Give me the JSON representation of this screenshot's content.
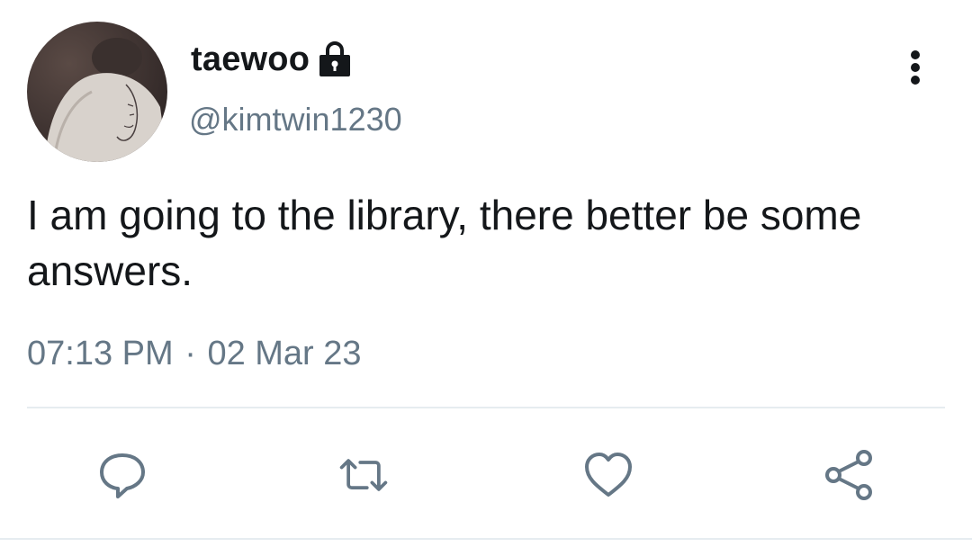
{
  "tweet": {
    "author": {
      "display_name": "taewoo",
      "handle": "@kimtwin1230",
      "protected": true,
      "avatar_icon": "profile-photo"
    },
    "text": "I am going to the library, there better be some answers.",
    "time": "07:13 PM",
    "separator": "·",
    "date": "02 Mar 23"
  },
  "actions": [
    {
      "name": "reply",
      "icon": "speech-bubble-icon"
    },
    {
      "name": "retweet",
      "icon": "retweet-arrows-icon"
    },
    {
      "name": "like",
      "icon": "heart-icon"
    },
    {
      "name": "share",
      "icon": "share-nodes-icon"
    }
  ],
  "colors": {
    "text_primary": "#14171a",
    "text_secondary": "#657786",
    "icon": "#657786",
    "divider": "#e6ecf0"
  }
}
